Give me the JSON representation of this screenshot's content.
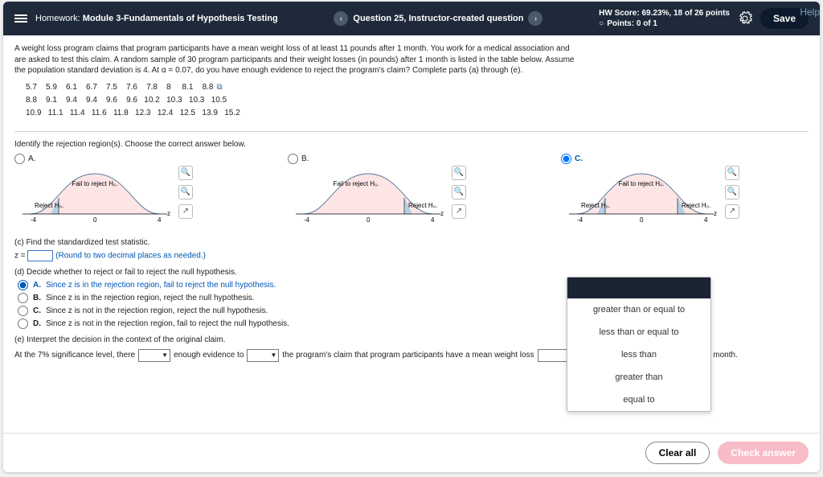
{
  "header": {
    "hw_label": "Homework:",
    "title": "Module 3-Fundamentals of Hypothesis Testing",
    "question": "Question 25, Instructor-created question",
    "score_line1": "HW Score: 69.23%, 18 of 26 points",
    "score_line2": "Points: 0 of 1",
    "save": "Save"
  },
  "help_text": "Help",
  "intro": "A weight loss program claims that program participants have a mean weight loss of at least 11 pounds after 1 month. You work for a medical association and are asked to test this claim. A random sample of 30 program participants and their weight losses (in pounds) after 1 month is listed in the table below. Assume the population standard deviation is 4. At α = 0.07, do you have enough evidence to reject the program's claim? Complete parts (a) through (e).",
  "data_rows": [
    "5.7    5.9    6.1    6.7    7.5    7.6    7.8    8     8.1    8.8",
    "8.8    9.1    9.4    9.4    9.6    9.6   10.2   10.3   10.3   10.5",
    "10.9   11.1   11.4   11.6   11.8   12.3   12.4   12.5   13.9   15.2"
  ],
  "identify_prompt": "Identify the rejection region(s). Choose the correct answer below.",
  "options": {
    "a": "A.",
    "b": "B.",
    "c": "C.",
    "fail_label": "Fail to reject H₀.",
    "reject_label": "Reject H₀."
  },
  "part_c": {
    "prompt": "(c) Find the standardized test statistic.",
    "z_prefix": "z =",
    "note": "(Round to two decimal places as needed.)"
  },
  "part_d": {
    "prompt": "(d) Decide whether to reject or fail to reject the null hypothesis.",
    "a": "Since z is in the rejection region, fail to reject the null hypothesis.",
    "b": "Since z is in the rejection region, reject the null hypothesis.",
    "c": "Since z is not in the rejection region, reject the null hypothesis.",
    "d": "Since z is not in the rejection region, fail to reject the null hypothesis."
  },
  "part_e": {
    "prompt": "(e) Interpret the decision in the context of the original claim.",
    "t1": "At the 7% significance level, there",
    "t2": "enough evidence to",
    "t3": "the program's claim that program participants have a mean weight loss",
    "t4": "pounds after 1 month."
  },
  "dropdown": {
    "items": [
      "greater than or equal to",
      "less than or equal to",
      "less than",
      "greater than",
      "equal to"
    ]
  },
  "footer": {
    "clear": "Clear all",
    "check": "Check answer"
  },
  "axis": {
    "n4": "-4",
    "z": "0",
    "p4": "4",
    "zlbl": "z"
  }
}
